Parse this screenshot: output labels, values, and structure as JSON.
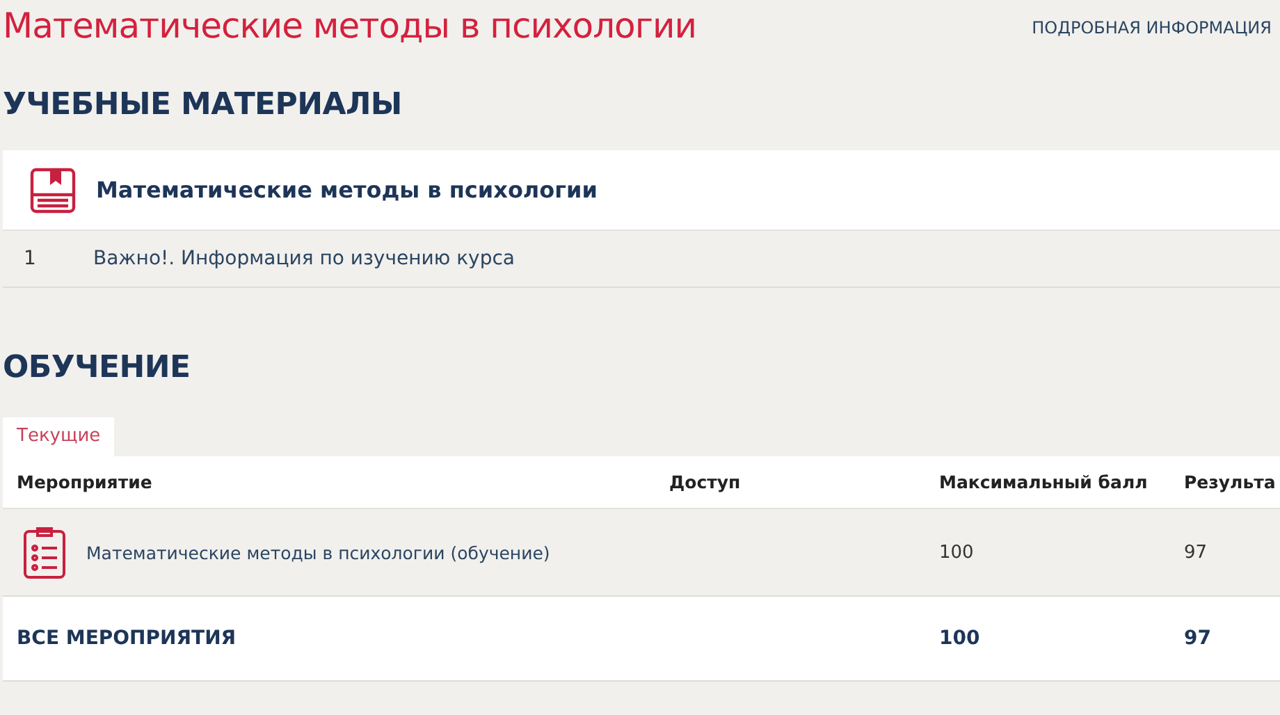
{
  "page_title": "Математические методы в психологии",
  "details_link": "ПОДРОБНАЯ ИНФОРМАЦИЯ",
  "materials": {
    "heading": "УЧЕБНЫЕ МАТЕРИАЛЫ",
    "course_title": "Математические методы в психологии",
    "items": [
      {
        "number": "1",
        "title": "Важно!. Информация по изучению курса"
      }
    ]
  },
  "training": {
    "heading": "ОБУЧЕНИЕ",
    "tabs": [
      {
        "label": "Текущие",
        "selected": true
      }
    ],
    "table": {
      "columns": [
        "Мероприятие",
        "Доступ",
        "Максимальный балл",
        "Результа"
      ],
      "rows": [
        {
          "event": "Математические методы в психологии (обучение)",
          "max_score": "100",
          "result": "97"
        }
      ],
      "total": {
        "label": "ВСЕ МЕРОПРИЯТИЯ",
        "max_score": "100",
        "result": "97"
      }
    }
  }
}
